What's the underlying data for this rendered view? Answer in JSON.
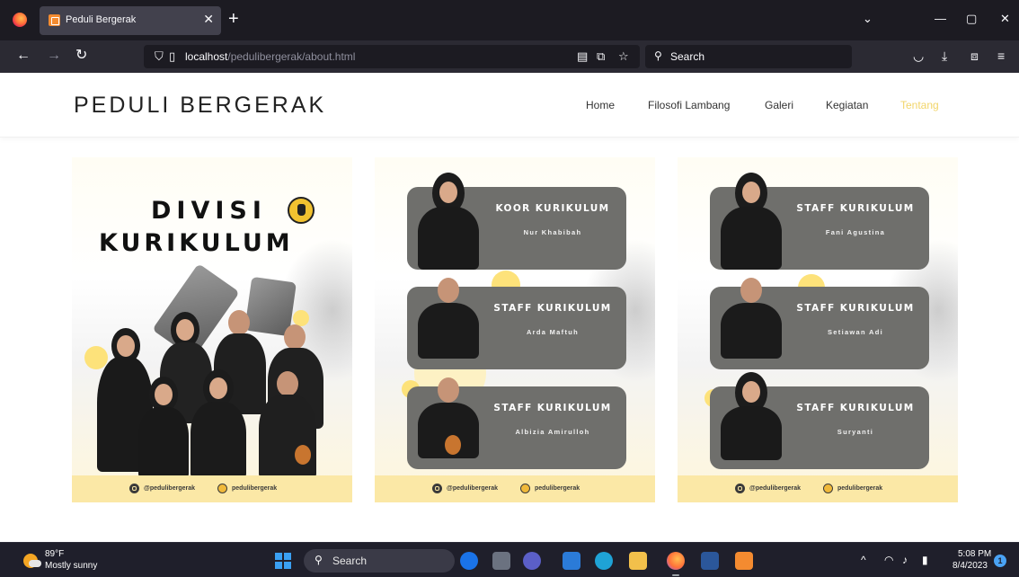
{
  "browser": {
    "tab_title": "Peduli Bergerak",
    "tab_close": "✕",
    "new_tab": "+",
    "url_host": "localhost",
    "url_path": "/pedulibergerak/about.html",
    "search_placeholder": "Search"
  },
  "site": {
    "brand": "PEDULI BERGERAK",
    "nav": [
      {
        "label": "Home",
        "active": false
      },
      {
        "label": "Filosofi Lambang",
        "active": false
      },
      {
        "label": "Galeri",
        "active": false
      },
      {
        "label": "Kegiatan",
        "active": false
      },
      {
        "label": "Tentang",
        "active": true
      }
    ],
    "accent_color": "#f2d56a"
  },
  "division_poster": {
    "title_line1": "DIVISI",
    "title_line2": "KURIKULUM"
  },
  "social": {
    "instagram": "@pedulibergerak",
    "other": "pedulibergerak"
  },
  "members_col1": [
    {
      "role": "KOOR KURIKULUM",
      "name": "Nur Khabibah"
    },
    {
      "role": "STAFF KURIKULUM",
      "name": "Arda Maftuh"
    },
    {
      "role": "STAFF KURIKULUM",
      "name": "Albizia Amirulloh"
    }
  ],
  "members_col2": [
    {
      "role": "STAFF KURIKULUM",
      "name": "Fani Agustina"
    },
    {
      "role": "STAFF KURIKULUM",
      "name": "Setiawan Adi"
    },
    {
      "role": "STAFF KURIKULUM",
      "name": "Suryanti"
    }
  ],
  "taskbar": {
    "temperature": "89°F",
    "condition": "Mostly sunny",
    "search_label": "Search",
    "time": "5:08 PM",
    "date": "8/4/2023",
    "notification_count": "1"
  }
}
